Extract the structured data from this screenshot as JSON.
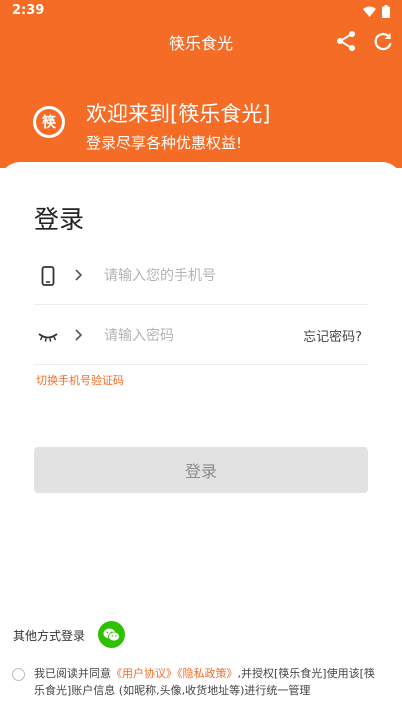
{
  "status": {
    "time": "2:39"
  },
  "appbar": {
    "title": "筷乐食光"
  },
  "banner": {
    "logo_char": "筷",
    "title": "欢迎来到[筷乐食光]",
    "subtitle": "登录尽享各种优惠权益!"
  },
  "login": {
    "title": "登录",
    "phone_placeholder": "请输入您的手机号",
    "password_placeholder": "请输入密码",
    "forgot_label": "忘记密码?",
    "switch_label": "切换手机号验证码",
    "submit_label": "登录"
  },
  "other": {
    "label": "其他方式登录"
  },
  "agreement": {
    "prefix": "我已阅读并同意",
    "user_agreement": "《用户协议》",
    "privacy_policy": "《隐私政策》",
    "suffix": ",并授权[筷乐食光]使用该[筷乐食光]账户信息 (如昵称,头像,收货地址等)进行统一管理"
  },
  "colors": {
    "brand": "#f56c26",
    "wechat": "#2dc100",
    "button_disabled": "#e2e2e2"
  }
}
